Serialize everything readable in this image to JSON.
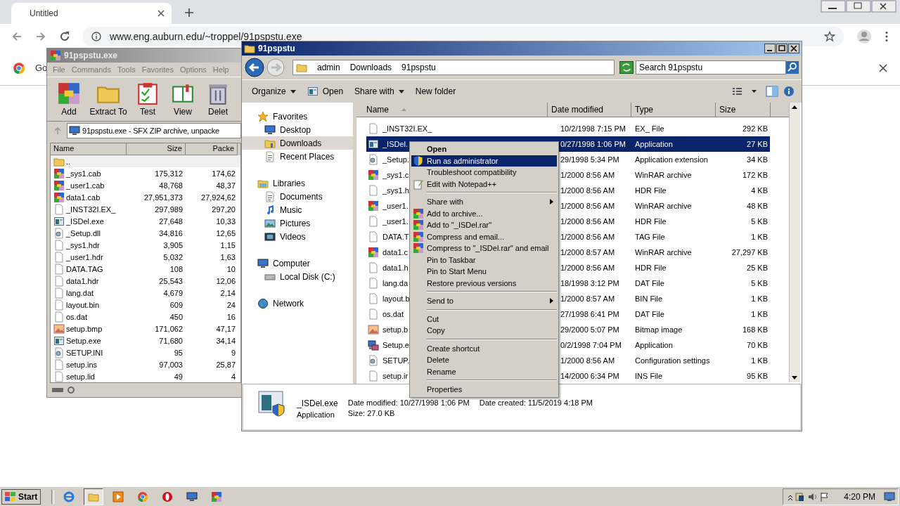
{
  "browser": {
    "tab_title": "Untitled",
    "url": "www.eng.auburn.edu/~troppel/91pspstu.exe",
    "infobar_text": "Go"
  },
  "winrar": {
    "title": "91pspstu.exe",
    "menu": [
      "File",
      "Commands",
      "Tools",
      "Favorites",
      "Options",
      "Help"
    ],
    "tools": [
      {
        "label": "Add",
        "kind": "rar"
      },
      {
        "label": "Extract To",
        "kind": "folder"
      },
      {
        "label": "Test",
        "kind": "test"
      },
      {
        "label": "View",
        "kind": "book"
      },
      {
        "label": "Delet",
        "kind": "trash"
      }
    ],
    "address": "91pspstu.exe - SFX ZIP archive, unpacke",
    "columns": [
      "Name",
      "Size",
      "Packe"
    ],
    "rows": [
      {
        "name": "..",
        "size": "",
        "packed": "",
        "kind": "folder"
      },
      {
        "name": "_sys1.cab",
        "size": "175,312",
        "packed": "174,62",
        "kind": "rar"
      },
      {
        "name": "_user1.cab",
        "size": "48,768",
        "packed": "48,37",
        "kind": "rar"
      },
      {
        "name": "data1.cab",
        "size": "27,951,373",
        "packed": "27,924,62",
        "kind": "rar"
      },
      {
        "name": "_INST32I.EX_",
        "size": "297,989",
        "packed": "297,20",
        "kind": "file"
      },
      {
        "name": "_ISDel.exe",
        "size": "27,648",
        "packed": "10,33",
        "kind": "app"
      },
      {
        "name": "_Setup.dll",
        "size": "34,816",
        "packed": "12,65",
        "kind": "dll"
      },
      {
        "name": "_sys1.hdr",
        "size": "3,905",
        "packed": "1,15",
        "kind": "file"
      },
      {
        "name": "_user1.hdr",
        "size": "5,032",
        "packed": "1,63",
        "kind": "file"
      },
      {
        "name": "DATA.TAG",
        "size": "108",
        "packed": "10",
        "kind": "file"
      },
      {
        "name": "data1.hdr",
        "size": "25,543",
        "packed": "12,06",
        "kind": "file"
      },
      {
        "name": "lang.dat",
        "size": "4,679",
        "packed": "2,14",
        "kind": "file"
      },
      {
        "name": "layout.bin",
        "size": "609",
        "packed": "24",
        "kind": "file"
      },
      {
        "name": "os.dat",
        "size": "450",
        "packed": "16",
        "kind": "file"
      },
      {
        "name": "setup.bmp",
        "size": "171,062",
        "packed": "47,17",
        "kind": "bmp"
      },
      {
        "name": "Setup.exe",
        "size": "71,680",
        "packed": "34,14",
        "kind": "app"
      },
      {
        "name": "SETUP.INI",
        "size": "95",
        "packed": "9",
        "kind": "ini"
      },
      {
        "name": "setup.ins",
        "size": "97,003",
        "packed": "25,87",
        "kind": "file"
      },
      {
        "name": "setup.lid",
        "size": "49",
        "packed": "4",
        "kind": "file"
      }
    ]
  },
  "explorer": {
    "title": "91pspstu",
    "breadcrumb": [
      "admin",
      "Downloads",
      "91pspstu"
    ],
    "search_placeholder": "Search 91pspstu",
    "commands": [
      {
        "label": "Organize",
        "kind": "menu"
      },
      {
        "label": "Open",
        "kind": "open"
      },
      {
        "label": "Share with",
        "kind": "menu"
      },
      {
        "label": "New folder",
        "kind": "plain"
      }
    ],
    "nav": [
      {
        "label": "Favorites",
        "kind": "star",
        "children": [
          {
            "label": "Desktop",
            "kind": "desktop",
            "selected": false
          },
          {
            "label": "Downloads",
            "kind": "downloads",
            "selected": true
          },
          {
            "label": "Recent Places",
            "kind": "recent",
            "selected": false
          }
        ]
      },
      {
        "label": "Libraries",
        "kind": "library",
        "children": [
          {
            "label": "Documents",
            "kind": "documents",
            "selected": false
          },
          {
            "label": "Music",
            "kind": "music",
            "selected": false
          },
          {
            "label": "Pictures",
            "kind": "pictures",
            "selected": false
          },
          {
            "label": "Videos",
            "kind": "videos",
            "selected": false
          }
        ]
      },
      {
        "label": "Computer",
        "kind": "computer",
        "children": [
          {
            "label": "Local Disk (C:)",
            "kind": "disk",
            "selected": false
          }
        ]
      },
      {
        "label": "Network",
        "kind": "network"
      }
    ],
    "columns": [
      "Name",
      "Date modified",
      "Type",
      "Size"
    ],
    "rows": [
      {
        "name": "_INST32I.EX_",
        "date": "10/2/1998 7:15 PM",
        "type": "EX_ File",
        "size": "292 KB",
        "kind": "file",
        "selected": false
      },
      {
        "name": "_ISDel.",
        "date": "0/27/1998 1:06 PM",
        "type": "Application",
        "size": "27 KB",
        "kind": "app",
        "selected": true
      },
      {
        "name": "_Setup.",
        "date": "29/1998 5:34 PM",
        "type": "Application extension",
        "size": "34 KB",
        "kind": "dll",
        "selected": false
      },
      {
        "name": "_sys1.c",
        "date": "1/2000 8:56 AM",
        "type": "WinRAR archive",
        "size": "172 KB",
        "kind": "rar",
        "selected": false
      },
      {
        "name": "_sys1.h",
        "date": "1/2000 8:56 AM",
        "type": "HDR File",
        "size": "4 KB",
        "kind": "file",
        "selected": false
      },
      {
        "name": "_user1.",
        "date": "1/2000 8:56 AM",
        "type": "WinRAR archive",
        "size": "48 KB",
        "kind": "rar",
        "selected": false
      },
      {
        "name": "_user1.",
        "date": "1/2000 8:56 AM",
        "type": "HDR File",
        "size": "5 KB",
        "kind": "file",
        "selected": false
      },
      {
        "name": "DATA.T",
        "date": "1/2000 8:56 AM",
        "type": "TAG File",
        "size": "1 KB",
        "kind": "file",
        "selected": false
      },
      {
        "name": "data1.c",
        "date": "1/2000 8:57 AM",
        "type": "WinRAR archive",
        "size": "27,297 KB",
        "kind": "rar",
        "selected": false
      },
      {
        "name": "data1.h",
        "date": "1/2000 8:56 AM",
        "type": "HDR File",
        "size": "25 KB",
        "kind": "file",
        "selected": false
      },
      {
        "name": "lang.da",
        "date": "18/1998 3:12 PM",
        "type": "DAT File",
        "size": "5 KB",
        "kind": "file",
        "selected": false
      },
      {
        "name": "layout.b",
        "date": "1/2000 8:57 AM",
        "type": "BIN File",
        "size": "1 KB",
        "kind": "file",
        "selected": false
      },
      {
        "name": "os.dat",
        "date": "27/1998 6:41 PM",
        "type": "DAT File",
        "size": "1 KB",
        "kind": "file",
        "selected": false
      },
      {
        "name": "setup.b",
        "date": "29/2000 5:07 PM",
        "type": "Bitmap image",
        "size": "168 KB",
        "kind": "bmp",
        "selected": false
      },
      {
        "name": "Setup.e",
        "date": "0/2/1998 7:04 PM",
        "type": "Application",
        "size": "70 KB",
        "kind": "setup",
        "selected": false
      },
      {
        "name": "SETUP.",
        "date": "1/2000 8:56 AM",
        "type": "Configuration settings",
        "size": "1 KB",
        "kind": "ini",
        "selected": false
      },
      {
        "name": "setup.ir",
        "date": "14/2000 6:34 PM",
        "type": "INS File",
        "size": "95 KB",
        "kind": "file",
        "selected": false
      }
    ],
    "details": {
      "name": "_ISDel.exe",
      "type": "Application",
      "modified": "Date modified: 10/27/1998 1:06 PM",
      "created": "Date created: 11/5/2019 4:18 PM",
      "size": "Size: 27.0 KB"
    },
    "context_menu": [
      [
        {
          "label": "Open",
          "default": true,
          "kind": "plain",
          "submenu": false,
          "selected": false
        },
        {
          "label": "Run as administrator",
          "default": false,
          "kind": "shield",
          "submenu": false,
          "selected": true
        },
        {
          "label": "Troubleshoot compatibility",
          "default": false,
          "kind": "plain",
          "submenu": false,
          "selected": false
        },
        {
          "label": "Edit with Notepad++",
          "default": false,
          "kind": "notepad",
          "submenu": false,
          "selected": false
        }
      ],
      [
        {
          "label": "Share with",
          "default": false,
          "kind": "plain",
          "submenu": true,
          "selected": false
        },
        {
          "label": "Add to archive...",
          "default": false,
          "kind": "rar",
          "submenu": false,
          "selected": false
        },
        {
          "label": "Add to \"_ISDel.rar\"",
          "default": false,
          "kind": "rar",
          "submenu": false,
          "selected": false
        },
        {
          "label": "Compress and email...",
          "default": false,
          "kind": "rar",
          "submenu": false,
          "selected": false
        },
        {
          "label": "Compress to \"_ISDel.rar\" and email",
          "default": false,
          "kind": "rar",
          "submenu": false,
          "selected": false
        },
        {
          "label": "Pin to Taskbar",
          "default": false,
          "kind": "plain",
          "submenu": false,
          "selected": false
        },
        {
          "label": "Pin to Start Menu",
          "default": false,
          "kind": "plain",
          "submenu": false,
          "selected": false
        },
        {
          "label": "Restore previous versions",
          "default": false,
          "kind": "plain",
          "submenu": false,
          "selected": false
        }
      ],
      [
        {
          "label": "Send to",
          "default": false,
          "kind": "plain",
          "submenu": true,
          "selected": false
        }
      ],
      [
        {
          "label": "Cut",
          "default": false,
          "kind": "plain",
          "submenu": false,
          "selected": false
        },
        {
          "label": "Copy",
          "default": false,
          "kind": "plain",
          "submenu": false,
          "selected": false
        }
      ],
      [
        {
          "label": "Create shortcut",
          "default": false,
          "kind": "plain",
          "submenu": false,
          "selected": false
        },
        {
          "label": "Delete",
          "default": false,
          "kind": "plain",
          "submenu": false,
          "selected": false
        },
        {
          "label": "Rename",
          "default": false,
          "kind": "plain",
          "submenu": false,
          "selected": false
        }
      ],
      [
        {
          "label": "Properties",
          "default": false,
          "kind": "plain",
          "submenu": false,
          "selected": false
        }
      ]
    ]
  },
  "taskbar": {
    "start": "Start",
    "apps": [
      {
        "kind": "ie",
        "selected": false
      },
      {
        "kind": "folder",
        "selected": true
      },
      {
        "kind": "media",
        "selected": false
      },
      {
        "kind": "chrome",
        "selected": false
      },
      {
        "kind": "opera",
        "selected": false
      },
      {
        "kind": "monitor",
        "selected": false
      },
      {
        "kind": "rar",
        "selected": false
      }
    ],
    "clock": "4:20 PM"
  }
}
